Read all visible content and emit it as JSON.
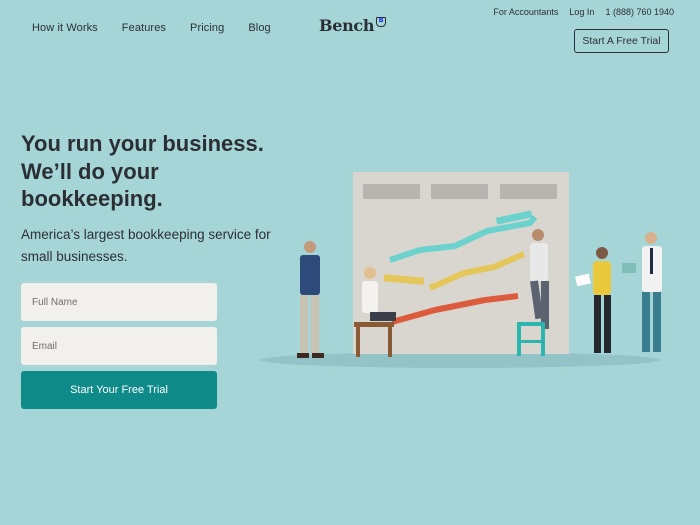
{
  "nav": {
    "items": [
      {
        "label": "How it Works"
      },
      {
        "label": "Features"
      },
      {
        "label": "Pricing"
      },
      {
        "label": "Blog"
      }
    ]
  },
  "brand": {
    "name": "Bench",
    "badge": "B"
  },
  "utility": {
    "accountants": "For Accountants",
    "login": "Log In",
    "phone": "1 (888) 760 1940"
  },
  "header_cta": {
    "label": "Start A Free Trial"
  },
  "hero": {
    "title": "You run your business. We’ll do your bookkeeping.",
    "subtitle": "America’s largest bookkeeping service for small businesses."
  },
  "form": {
    "name_placeholder": "Full Name",
    "email_placeholder": "Email",
    "submit_label": "Start Your Free Trial"
  },
  "colors": {
    "background": "#a6d5d8",
    "primary": "#0e8a89",
    "text": "#2b2f33",
    "field": "#f2f0ec"
  },
  "illustration": {
    "icon": "team-building-growth-chart-illustration"
  }
}
